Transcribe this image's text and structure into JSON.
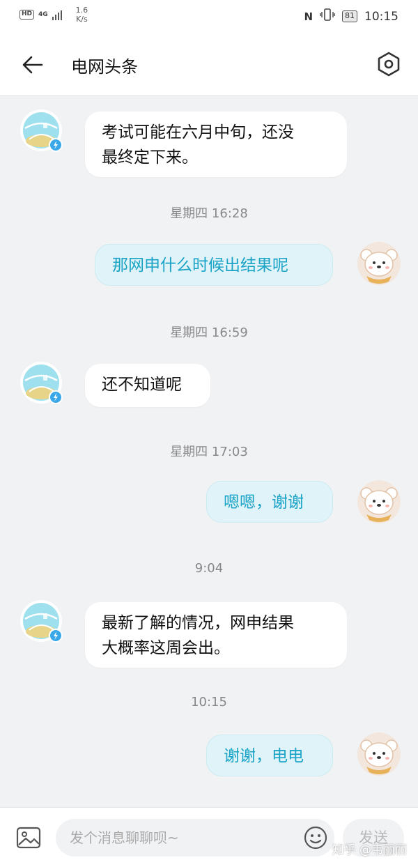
{
  "status_bar": {
    "hd": "HD",
    "network": "4G",
    "speed_value": "1.6",
    "speed_unit": "K/s",
    "battery": "81",
    "time": "10:15"
  },
  "header": {
    "title": "电网头条"
  },
  "messages": [
    {
      "type": "in",
      "text": "考试可能在六月中旬，还没\n最终定下来。"
    },
    {
      "type": "timestamp",
      "text": "星期四 16:28"
    },
    {
      "type": "out",
      "text": "那网申什么时候出结果呢"
    },
    {
      "type": "timestamp",
      "text": "星期四 16:59"
    },
    {
      "type": "in",
      "text": "还不知道呢"
    },
    {
      "type": "timestamp",
      "text": "星期四 17:03"
    },
    {
      "type": "out",
      "text": "嗯嗯，谢谢"
    },
    {
      "type": "timestamp",
      "text": "9:04"
    },
    {
      "type": "in",
      "text": "最新了解的情况，网申结果\n大概率这周会出。"
    },
    {
      "type": "timestamp",
      "text": "10:15"
    },
    {
      "type": "out",
      "text": "谢谢，电电"
    }
  ],
  "input_bar": {
    "placeholder": "发个消息聊聊呗~",
    "send_label": "发送",
    "watermark": "知乎 @韦丽丽"
  },
  "colors": {
    "outgoing_text": "#1aa3c6",
    "outgoing_bg": "#dff3f8",
    "chat_bg": "#f1f2f4"
  }
}
